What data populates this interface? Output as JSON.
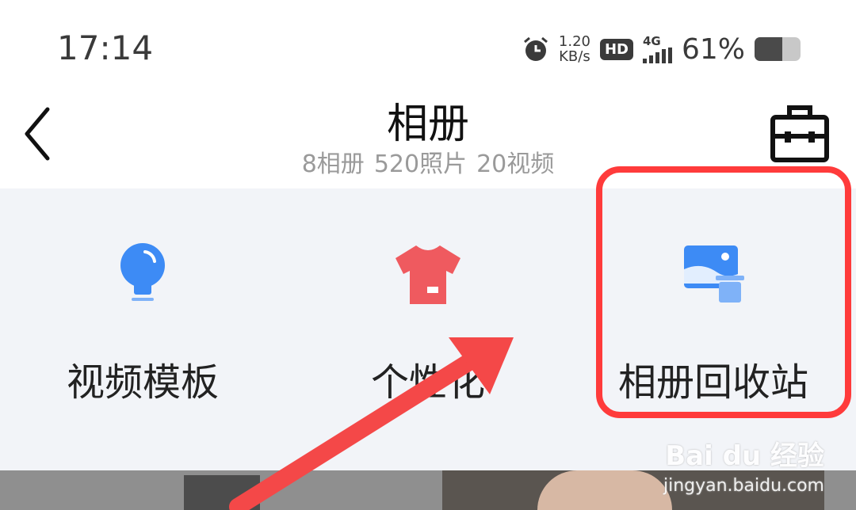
{
  "status_bar": {
    "time": "17:14",
    "net_speed_value": "1.20",
    "net_speed_unit": "KB/s",
    "hd_badge": "HD",
    "network_type": "4G",
    "battery_percent": "61%",
    "battery_level": 0.61,
    "alarm_icon": "alarm-clock-icon"
  },
  "header": {
    "back_icon": "chevron-left-icon",
    "title": "相册",
    "stats": {
      "albums": "8相册",
      "photos": "520照片",
      "videos": "20视频"
    },
    "toolbox_icon": "toolbox-icon"
  },
  "tools": [
    {
      "label": "视频模板",
      "icon": "lightbulb-icon",
      "color": "#3d8bf5"
    },
    {
      "label": "个性化",
      "icon": "tshirt-icon",
      "color": "#ef5a5f"
    },
    {
      "label": "相册回收站",
      "icon": "photo-trash-icon",
      "color": "#3d8bf5"
    }
  ],
  "annotation": {
    "highlight_color": "#ff3b3b",
    "arrow_color": "#f44848"
  },
  "watermark": {
    "brand": "Bai du 经验",
    "url": "jingyan.baidu.com"
  }
}
